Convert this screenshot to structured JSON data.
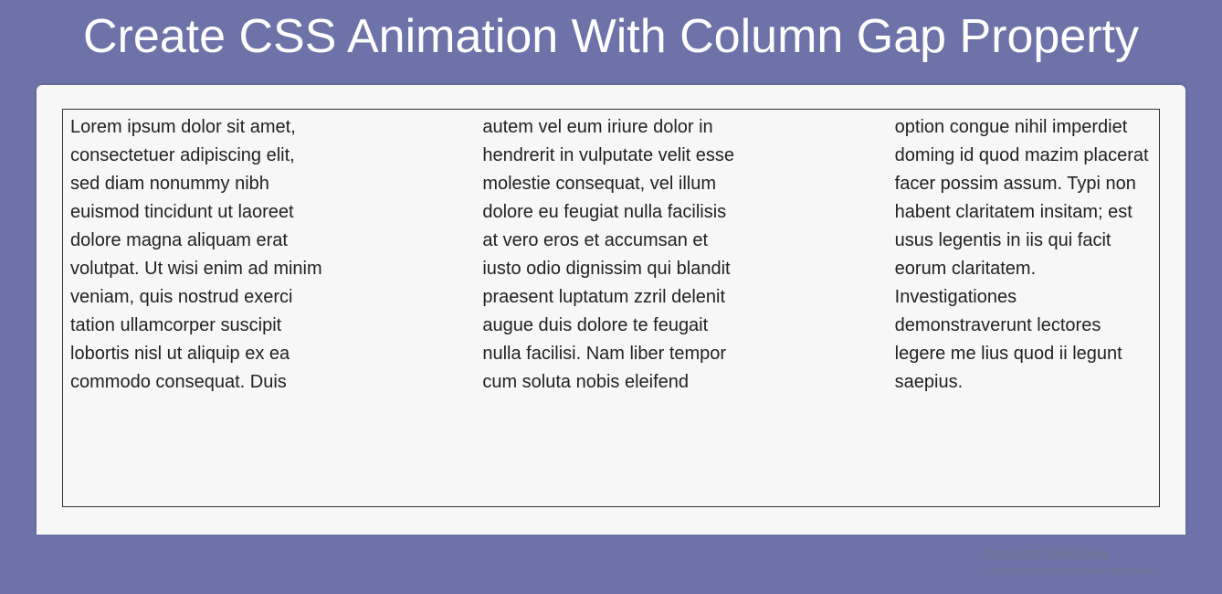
{
  "title": "Create CSS Animation With Column Gap Property",
  "body_text": "Lorem ipsum dolor sit amet, consectetuer adipiscing elit, sed diam nonummy nibh euismod tincidunt ut laoreet dolore magna aliquam erat volutpat. Ut wisi enim ad minim veniam, quis nostrud exerci tation ullamcorper suscipit lobortis nisl ut aliquip ex ea commodo consequat. Duis autem vel eum iriure dolor in hendrerit in vulputate velit esse molestie consequat, vel illum dolore eu feugiat nulla facilisis at vero eros et accumsan et iusto odio dignissim qui blandit praesent luptatum zzril delenit augue duis dolore te feugait nulla facilisi. Nam liber tempor cum soluta nobis eleifend option congue nihil imperdiet doming id quod mazim placerat facer possim assum. Typi non habent claritatem insitam; est usus legentis in iis qui facit eorum claritatem. Investigationes demonstraverunt lectores legere me lius quod ii legunt saepius.",
  "watermark": {
    "line1": "Activate Windows",
    "line2": "Go to Settings to activate Windows."
  }
}
